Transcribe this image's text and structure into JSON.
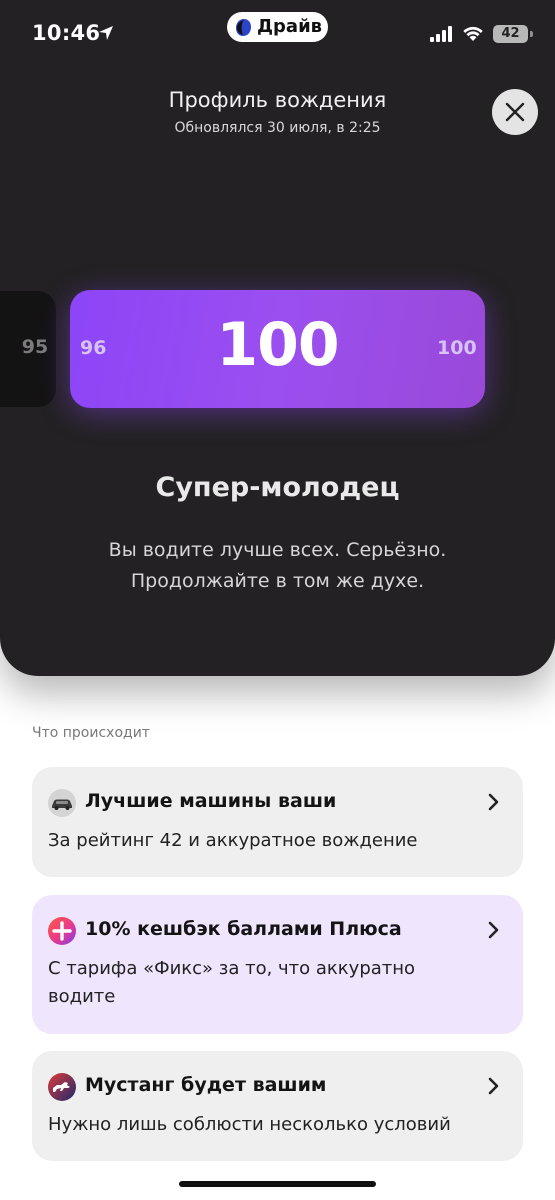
{
  "status_bar": {
    "time": "10:46",
    "battery": "42",
    "icons": [
      "location-arrow-icon",
      "signal-icon",
      "wifi-icon",
      "battery-icon"
    ]
  },
  "app_pill": {
    "label": "Драйв",
    "logo": "drive-logo-icon"
  },
  "header": {
    "title": "Профиль вождения",
    "subtitle": "Обновлялся 30 июля, в 2:25",
    "close_icon": "close-icon"
  },
  "score": {
    "previous": "95",
    "range_min": "96",
    "current": "100",
    "range_max": "100"
  },
  "rating": {
    "title": "Супер-молодец",
    "description": "Вы водите лучше всех. Серьёзно. Продолжайте в том же духе."
  },
  "section": {
    "label": "Что происходит",
    "cards": [
      {
        "title": "Лучшие машины ваши",
        "text": "За рейтинг 42 и аккуратное вождение",
        "icon": "car-icon",
        "background": "#efefef"
      },
      {
        "title": "10% кешбэк баллами Плюса",
        "text": "С тарифа «Фикс» за то, что аккуратно водите",
        "icon": "plus-cashback-icon",
        "background": "#efe5fd"
      },
      {
        "title": "Мустанг будет вашим",
        "text": "Нужно лишь соблюсти несколько условий",
        "icon": "mustang-icon",
        "background": "#efefef"
      }
    ]
  },
  "colors": {
    "panel": "#232123",
    "score_gradient_start": "#8c45f7",
    "score_gradient_end": "#9a49d8",
    "card_highlight": "#efe5fd"
  }
}
